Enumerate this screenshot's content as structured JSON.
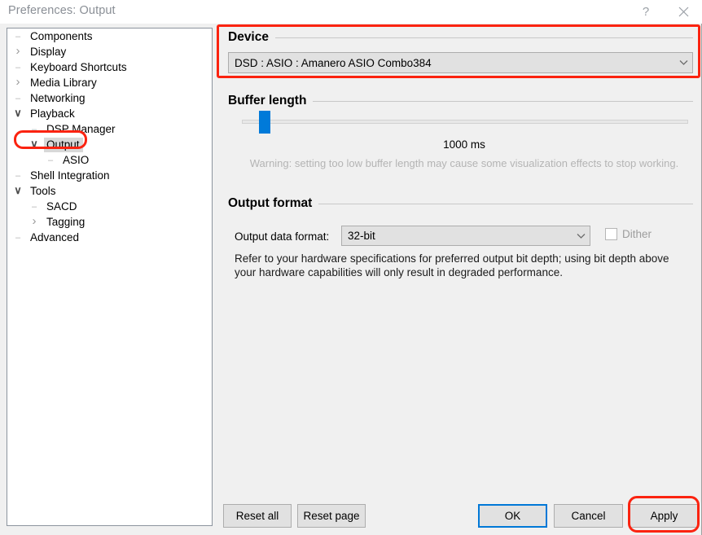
{
  "window": {
    "title": "Preferences: Output",
    "help_icon": "question-mark-icon",
    "close_icon": "close-icon"
  },
  "sidebar": {
    "items": [
      {
        "label": "Components",
        "depth": 0,
        "marker": "leaf",
        "selected": false
      },
      {
        "label": "Display",
        "depth": 0,
        "marker": "collapsed",
        "selected": false
      },
      {
        "label": "Keyboard Shortcuts",
        "depth": 0,
        "marker": "leaf",
        "selected": false
      },
      {
        "label": "Media Library",
        "depth": 0,
        "marker": "collapsed",
        "selected": false
      },
      {
        "label": "Networking",
        "depth": 0,
        "marker": "leaf",
        "selected": false
      },
      {
        "label": "Playback",
        "depth": 0,
        "marker": "expanded",
        "selected": false
      },
      {
        "label": "DSP Manager",
        "depth": 1,
        "marker": "leaf",
        "selected": false
      },
      {
        "label": "Output",
        "depth": 1,
        "marker": "expanded",
        "selected": true
      },
      {
        "label": "ASIO",
        "depth": 2,
        "marker": "leaf",
        "selected": false
      },
      {
        "label": "Shell Integration",
        "depth": 0,
        "marker": "leaf",
        "selected": false
      },
      {
        "label": "Tools",
        "depth": 0,
        "marker": "expanded",
        "selected": false
      },
      {
        "label": "SACD",
        "depth": 1,
        "marker": "leaf",
        "selected": false
      },
      {
        "label": "Tagging",
        "depth": 1,
        "marker": "collapsed",
        "selected": false
      },
      {
        "label": "Advanced",
        "depth": 0,
        "marker": "leaf",
        "selected": false
      }
    ]
  },
  "device_group": {
    "title": "Device",
    "selected_device": "DSD : ASIO : Amanero ASIO Combo384",
    "dropdown_icon": "chevron-down-icon"
  },
  "buffer_group": {
    "title": "Buffer length",
    "value_label": "1000 ms",
    "warning": "Warning: setting too low buffer length may cause some visualization effects to stop working.",
    "slider_percent": 4
  },
  "format_group": {
    "title": "Output format",
    "data_format_label": "Output data format:",
    "data_format_value": "32-bit",
    "dropdown_icon": "chevron-down-icon",
    "dither_label": "Dither",
    "dither_checked": false,
    "note": "Refer to your hardware specifications for preferred output bit depth; using bit depth above your hardware capabilities will only result in degraded performance."
  },
  "footer": {
    "reset_all": "Reset all",
    "reset_page": "Reset page",
    "ok": "OK",
    "cancel": "Cancel",
    "apply": "Apply"
  },
  "colors": {
    "accent_blue": "#0078d7",
    "slider_blue": "#007ad9",
    "annotation_red": "#fb2310",
    "dialog_bg": "#f0f0f0",
    "control_bg": "#e1e1e1"
  }
}
